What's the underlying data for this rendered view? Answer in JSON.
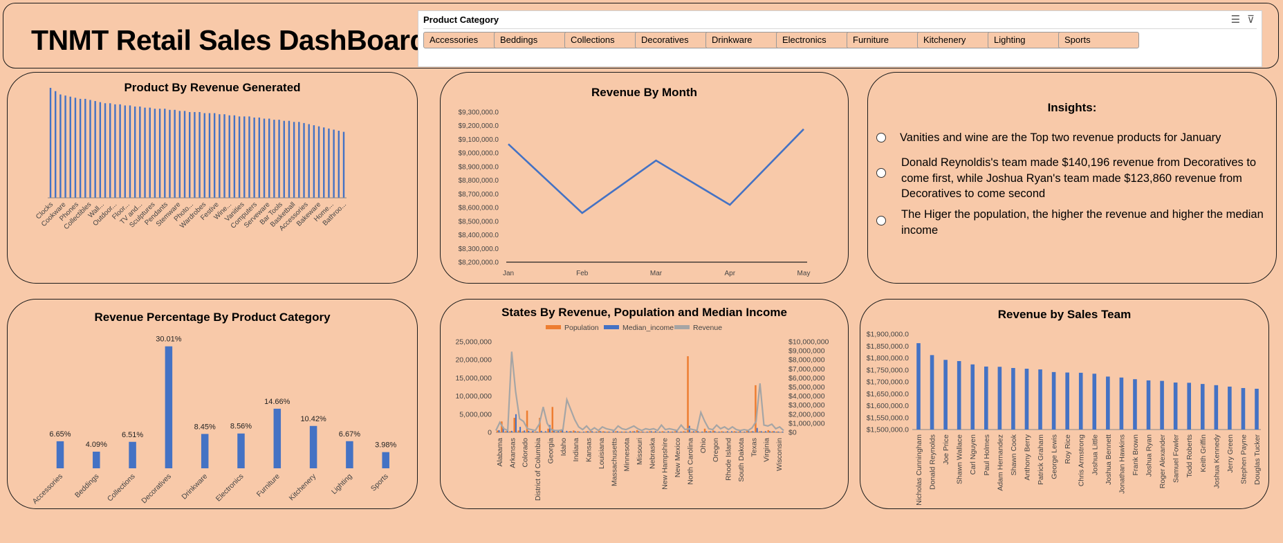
{
  "header": {
    "title": "TNMT Retail Sales DashBoard"
  },
  "slicer": {
    "title": "Product Category",
    "items": [
      "Accessories",
      "Beddings",
      "Collections",
      "Decoratives",
      "Drinkware",
      "Electronics",
      "Furniture",
      "Kitchenery",
      "Lighting",
      "Sports"
    ]
  },
  "insights": {
    "title": "Insights:",
    "items": [
      "Vanities and wine are the Top two revenue products for January",
      "Donald Reynoldis's team made $140,196 revenue from Decoratives to come first, while Joshua Ryan's team made $123,860 revenue from Decoratives to come second",
      "The Higer the population, the higher the revenue and higher the median income"
    ]
  },
  "chart_data": [
    {
      "type": "bar",
      "title": "Product By Revenue Generated",
      "xlabel": "",
      "ylabel": "",
      "tick_labels": [
        "Clocks",
        "Cookware",
        "Phones",
        "Collectibles",
        "Wall...",
        "Outdoor...",
        "Floor...",
        "TV and...",
        "Sculptures",
        "Pendants",
        "Stemware",
        "Photo...",
        "Wardrobes",
        "Festive",
        "Wine...",
        "Vanities",
        "Computers",
        "Serveware",
        "Bar Tools",
        "Basketball",
        "Accessories",
        "Bakeware",
        "Home...",
        "Bathroo..."
      ],
      "values": [
        100,
        97,
        94,
        93,
        92,
        91,
        90,
        90,
        89,
        88,
        87,
        86,
        86,
        85,
        85,
        84,
        84,
        83,
        83,
        82,
        82,
        81,
        81,
        81,
        80,
        80,
        79,
        79,
        78,
        78,
        78,
        77,
        77,
        77,
        76,
        76,
        75,
        75,
        74,
        74,
        74,
        73,
        73,
        72,
        72,
        71,
        71,
        70,
        70,
        69,
        69,
        68,
        67,
        66,
        65,
        64,
        63,
        62,
        61,
        60
      ]
    },
    {
      "type": "line",
      "title": "Revenue By Month",
      "categories": [
        "Jan",
        "Feb",
        "Mar",
        "Apr",
        "May"
      ],
      "values": [
        9065000,
        8560000,
        8945000,
        8620000,
        9175000
      ],
      "ylim": [
        8200000,
        9300000
      ],
      "yticks": [
        "$9,300,000.0",
        "$9,200,000.0",
        "$9,100,000.0",
        "$9,000,000.0",
        "$8,900,000.0",
        "$8,800,000.0",
        "$8,700,000.0",
        "$8,600,000.0",
        "$8,500,000.0",
        "$8,400,000.0",
        "$8,300,000.0",
        "$8,200,000.0"
      ]
    },
    {
      "type": "bar",
      "title": "Revenue Percentage By Product Category",
      "categories": [
        "Accessories",
        "Beddings",
        "Collections",
        "Decoratives",
        "Drinkware",
        "Electronics",
        "Furniture",
        "Kitchenery",
        "Lighting",
        "Sports"
      ],
      "values": [
        6.65,
        4.09,
        6.51,
        30.01,
        8.45,
        8.56,
        14.66,
        10.42,
        6.67,
        3.98
      ],
      "labels": [
        "6.65%",
        "4.09%",
        "6.51%",
        "30.01%",
        "8.45%",
        "8.56%",
        "14.66%",
        "10.42%",
        "6.67%",
        "3.98%"
      ],
      "ylim": [
        0,
        32
      ]
    },
    {
      "type": "line",
      "title": "States By Revenue, Population and Median Income",
      "legend": [
        "Population",
        "Median_income",
        "Revenue"
      ],
      "tick_labels": [
        "Alabama",
        "Arkansas",
        "Colorado",
        "District of Columbia",
        "Georgia",
        "Idaho",
        "Indiana",
        "Kansas",
        "Louisiana",
        "Massachusetts",
        "Minnesota",
        "Missouri",
        "Nebraska",
        "New Hampshire",
        "New Mexico",
        "North Carolina",
        "Ohio",
        "Oregon",
        "Rhode Island",
        "South Dakota",
        "Texas",
        "Virginia",
        "Wisconsin"
      ],
      "y_left_ticks": [
        "25,000,000",
        "20,000,000",
        "15,000,000",
        "10,000,000",
        "5,000,000",
        "0"
      ],
      "y_right_ticks": [
        "$10,000,000",
        "$9,000,000",
        "$8,000,000",
        "$7,000,000",
        "$6,000,000",
        "$5,000,000",
        "$4,000,000",
        "$3,000,000",
        "$2,000,000",
        "$1,000,000",
        "$0"
      ],
      "ylim_left": [
        0,
        25000000
      ],
      "ylim_right": [
        0,
        10000000
      ],
      "population": [
        0.5,
        3,
        0.3,
        0.3,
        4,
        0.5,
        0.3,
        6,
        0.2,
        0.2,
        4,
        0.1,
        1,
        7,
        0.2,
        0.6,
        0.1,
        0.3,
        0.5,
        0.3,
        0.1,
        0.3,
        0.3,
        0.1,
        0.4,
        0.3,
        0.2,
        0.1,
        0.3,
        0.2,
        0.2,
        0.1,
        0.3,
        0.6,
        0.2,
        0.1,
        0.3,
        0.2,
        0.1,
        0.3,
        0.1,
        0.2,
        0.3,
        0.1,
        0.3,
        21,
        0.2,
        0.4,
        0.1,
        1,
        0.3,
        0.5,
        0.1,
        0.3,
        0.2,
        0.1,
        0.3,
        0.2,
        0.1,
        0.4,
        0.3,
        13,
        0.3,
        0.2,
        0.6,
        0.3,
        0.2,
        0.1
      ],
      "median_income": [
        0.6,
        1.5,
        0.5,
        0.4,
        5,
        1.5,
        0.5,
        0.4,
        0.4,
        0.2,
        0.4,
        0.3,
        2,
        0.6,
        0.5,
        0.6,
        0.4,
        0.3,
        0.3,
        0.2,
        0.2,
        0.3,
        0.3,
        0.2,
        0.3,
        0.2,
        0.2,
        0.3,
        0.3,
        0.2,
        0.2,
        0.3,
        0.3,
        0.3,
        0.2,
        0.2,
        0.3,
        0.3,
        0.2,
        0.2,
        0.3,
        0.2,
        0.3,
        0.2,
        0.2,
        1.8,
        0.3,
        0.3,
        0.2,
        0.3,
        0.3,
        0.3,
        0.2,
        0.2,
        0.3,
        0.3,
        0.2,
        0.3,
        0.2,
        0.3,
        0.3,
        1.2,
        0.3,
        0.3,
        0.3,
        0.3,
        0.2,
        0.2
      ],
      "revenue": [
        0.2,
        1.1,
        0.4,
        0.2,
        8.9,
        4.5,
        1.5,
        1.2,
        0.4,
        0.3,
        0.2,
        0.9,
        2.8,
        1,
        0.3,
        0.2,
        0.2,
        0.3,
        3.6,
        2.5,
        1.4,
        0.6,
        0.3,
        0.7,
        0.2,
        0.5,
        0.2,
        0.6,
        0.4,
        0.3,
        0.2,
        0.7,
        0.4,
        0.3,
        0.5,
        0.7,
        0.4,
        0.2,
        0.4,
        0.3,
        0.4,
        0.2,
        0.8,
        0.3,
        0.4,
        0.3,
        0.2,
        0.8,
        0.3,
        0.4,
        0.3,
        0.2,
        2.2,
        1.2,
        0.4,
        0.3,
        0.8,
        0.4,
        0.6,
        0.3,
        0.6,
        0.3,
        0.2,
        0.3,
        0.2,
        0.5,
        1.2,
        5.4,
        0.8,
        0.7,
        0.9,
        0.4,
        0.6,
        0.2
      ]
    },
    {
      "type": "bar",
      "title": "Revenue by Sales Team",
      "categories": [
        "Nicholas Cunningham",
        "Donald Reynolds",
        "Joe Price",
        "Shawn Wallace",
        "Carl Nguyen",
        "Paul Holmes",
        "Adam Hernandez",
        "Shawn Cook",
        "Anthony Berry",
        "Patrick Graham",
        "George Lewis",
        "Roy Rice",
        "Chris Armstrong",
        "Joshua Little",
        "Joshua Bennett",
        "Jonathan Hawkins",
        "Frank Brown",
        "Joshua Ryan",
        "Roger Alexander",
        "Samuel Fowler",
        "Todd Roberts",
        "Keith Griffin",
        "Joshua Kennedy",
        "Jerry Green",
        "Stephen Payne",
        "Douglas Tucker"
      ],
      "values": [
        1862000,
        1812000,
        1792000,
        1787000,
        1773000,
        1764000,
        1763000,
        1758000,
        1755000,
        1752000,
        1741000,
        1739000,
        1738000,
        1734000,
        1722000,
        1718000,
        1711000,
        1706000,
        1704000,
        1697000,
        1696000,
        1691000,
        1686000,
        1680000,
        1674000,
        1671000
      ],
      "ylim": [
        1500000,
        1900000
      ],
      "yticks": [
        "$1,900,000.0",
        "$1,850,000.0",
        "$1,800,000.0",
        "$1,750,000.0",
        "$1,700,000.0",
        "$1,650,000.0",
        "$1,600,000.0",
        "$1,550,000.0",
        "$1,500,000.0"
      ]
    }
  ],
  "colors": {
    "bar": "#4472c4",
    "population": "#ed7d31",
    "revenue_line": "#a5a5a5",
    "background": "#f8c9a9"
  }
}
